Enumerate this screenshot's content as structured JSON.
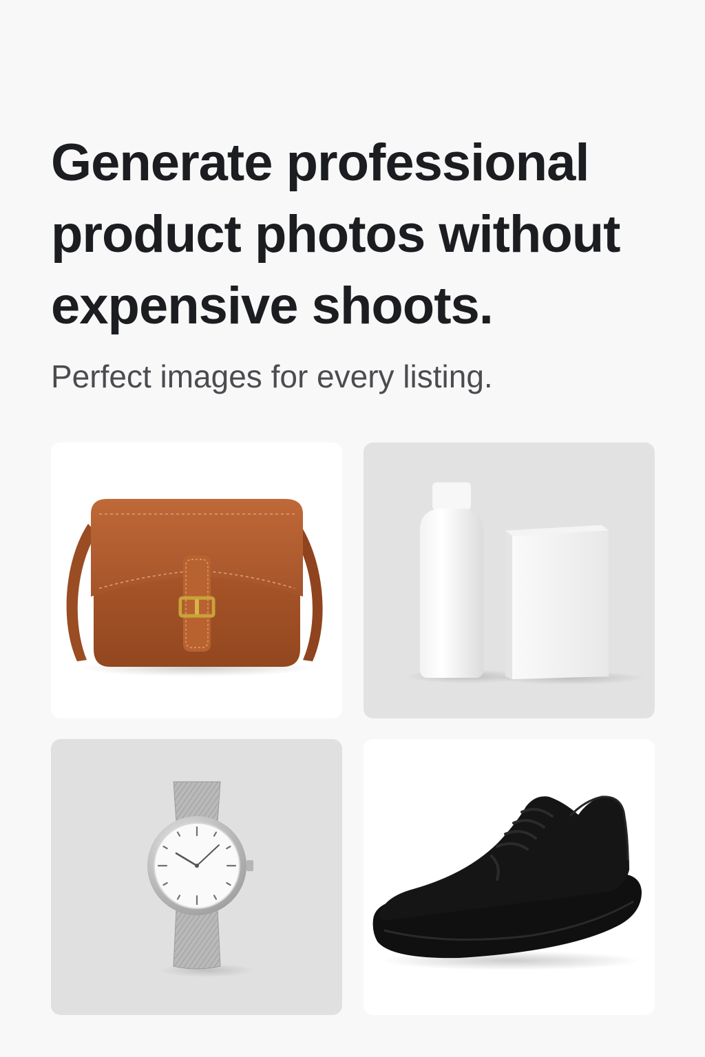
{
  "hero": {
    "headline": "Generate professional product photos without expensive shoots.",
    "subheadline": "Perfect  images for every listing."
  },
  "gallery": [
    {
      "product": "leather-crossbody-bag",
      "background": "#ffffff",
      "accent": "#a95428"
    },
    {
      "product": "white-bottle-and-box",
      "background": "#e2e2e2",
      "accent": "#ffffff"
    },
    {
      "product": "silver-mesh-watch",
      "background": "#e0e0e0",
      "accent": "#c2c2c2"
    },
    {
      "product": "black-knit-sneaker",
      "background": "#ffffff",
      "accent": "#141414"
    }
  ]
}
